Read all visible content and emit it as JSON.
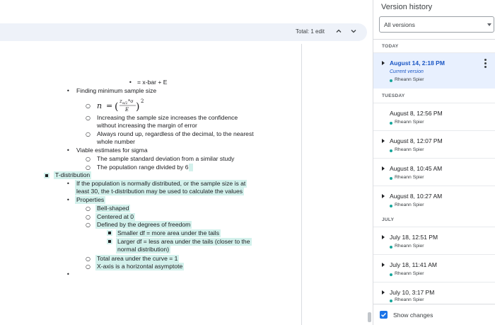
{
  "toolbar": {
    "total_edits": "Total: 1 edit",
    "prev_icon": "chevron-up-icon",
    "next_icon": "chevron-down-icon"
  },
  "document": {
    "line1": "= x-bar + E",
    "line2": "Finding minimum sample size",
    "formula": {
      "n": "n",
      "eq": "=",
      "z": "z",
      "sub": "α/2",
      "sigma": "*σ",
      "E": "E",
      "exp": "2"
    },
    "line3a": "Increasing the sample size increases the confidence",
    "line3b": "without increasing the margin of error",
    "line4a": "Always round up, regardless of the decimal, to the nearest",
    "line4b": "whole number",
    "line5": "Viable estimates for sigma",
    "line6": "The sample standard deviation from a similar study",
    "line7": "The population range divided by 6",
    "line8": "T-distribution",
    "line9a": "If the population is normally distributed, or the sample size is at",
    "line9b": "least 30, the t-distribution may be used to calculate the values",
    "line10": "Properties",
    "line11": "Bell-shaped",
    "line12": "Centered at 0",
    "line13": "Defined by the degrees of freedom",
    "line14": "Smaller df = more area under the tails",
    "line15a": "Larger df = less area under the tails (closer to the",
    "line15b": "normal distribution)",
    "line16": "Total area under the curve = 1",
    "line17": "X-axis is a horizontal asymptote"
  },
  "panel": {
    "title": "Version history",
    "filter_value": "All versions",
    "groups": {
      "today": "TODAY",
      "tuesday": "TUESDAY",
      "july": "JULY"
    },
    "versions": [
      {
        "date": "August 14, 2:18 PM",
        "current": "Current version",
        "author": "Rheann Spier"
      },
      {
        "date": "August 8, 12:56 PM",
        "author": "Rheann Spier"
      },
      {
        "date": "August 8, 12:07 PM",
        "author": "Rheann Spier"
      },
      {
        "date": "August 8, 10:45 AM",
        "author": "Rheann Spier"
      },
      {
        "date": "August 8, 10:27 AM",
        "author": "Rheann Spier"
      },
      {
        "date": "July 18, 12:51 PM",
        "author": "Rheann Spier"
      },
      {
        "date": "July 18, 11:41 AM",
        "author": "Rheann Spier"
      },
      {
        "date": "July 10, 3:17 PM",
        "author": "Rheann Spier"
      }
    ],
    "show_changes_label": "Show changes",
    "show_changes_checked": true,
    "menu_icon": "more-vert-icon",
    "check_icon": "checkmark-icon"
  },
  "colors": {
    "highlight": "#d3f1ec",
    "author_dot": "#18a69b",
    "selected_bg": "#e8f0fe",
    "accent": "#1a73e8"
  }
}
